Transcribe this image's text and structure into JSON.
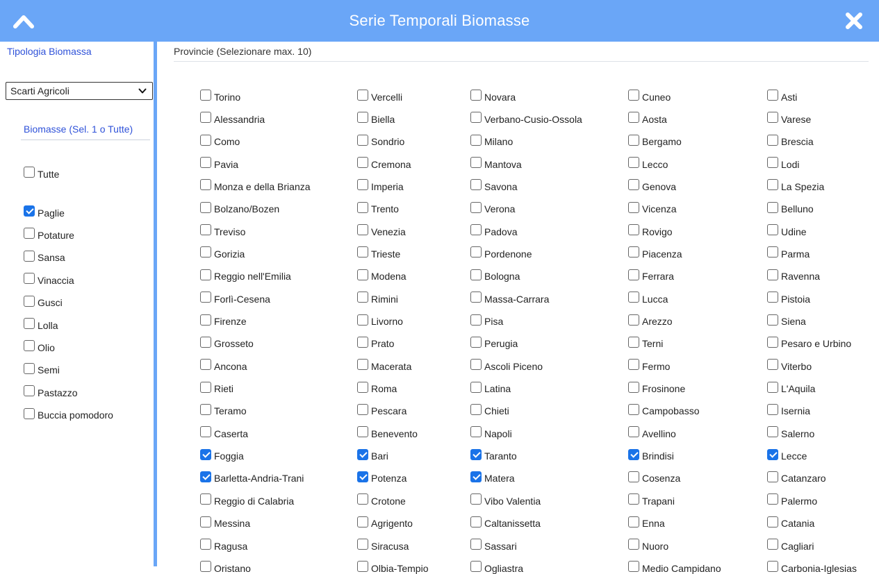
{
  "header": {
    "title": "Serie Temporali Biomasse"
  },
  "left": {
    "tipologia_label": "Tipologia Biomassa",
    "select_value": "Scarti Agricoli",
    "biomasse_label": "Biomasse (Sel. 1 o Tutte)",
    "tutte": {
      "label": "Tutte",
      "checked": false
    },
    "items": [
      {
        "label": "Paglie",
        "checked": true
      },
      {
        "label": "Potature",
        "checked": false
      },
      {
        "label": "Sansa",
        "checked": false
      },
      {
        "label": "Vinaccia",
        "checked": false
      },
      {
        "label": "Gusci",
        "checked": false
      },
      {
        "label": "Lolla",
        "checked": false
      },
      {
        "label": "Olio",
        "checked": false
      },
      {
        "label": "Semi",
        "checked": false
      },
      {
        "label": "Pastazzo",
        "checked": false
      },
      {
        "label": "Buccia pomodoro",
        "checked": false
      }
    ]
  },
  "right": {
    "province_label": "Provincie (Selezionare max. 10)",
    "province": [
      {
        "label": "Torino",
        "checked": false
      },
      {
        "label": "Vercelli",
        "checked": false
      },
      {
        "label": "Novara",
        "checked": false
      },
      {
        "label": "Cuneo",
        "checked": false
      },
      {
        "label": "Asti",
        "checked": false
      },
      {
        "label": "Alessandria",
        "checked": false
      },
      {
        "label": "Biella",
        "checked": false
      },
      {
        "label": "Verbano-Cusio-Ossola",
        "checked": false
      },
      {
        "label": "Aosta",
        "checked": false
      },
      {
        "label": "Varese",
        "checked": false
      },
      {
        "label": "Como",
        "checked": false
      },
      {
        "label": "Sondrio",
        "checked": false
      },
      {
        "label": "Milano",
        "checked": false
      },
      {
        "label": "Bergamo",
        "checked": false
      },
      {
        "label": "Brescia",
        "checked": false
      },
      {
        "label": "Pavia",
        "checked": false
      },
      {
        "label": "Cremona",
        "checked": false
      },
      {
        "label": "Mantova",
        "checked": false
      },
      {
        "label": "Lecco",
        "checked": false
      },
      {
        "label": "Lodi",
        "checked": false
      },
      {
        "label": "Monza e della Brianza",
        "checked": false
      },
      {
        "label": "Imperia",
        "checked": false
      },
      {
        "label": "Savona",
        "checked": false
      },
      {
        "label": "Genova",
        "checked": false
      },
      {
        "label": "La Spezia",
        "checked": false
      },
      {
        "label": "Bolzano/Bozen",
        "checked": false
      },
      {
        "label": "Trento",
        "checked": false
      },
      {
        "label": "Verona",
        "checked": false
      },
      {
        "label": "Vicenza",
        "checked": false
      },
      {
        "label": "Belluno",
        "checked": false
      },
      {
        "label": "Treviso",
        "checked": false
      },
      {
        "label": "Venezia",
        "checked": false
      },
      {
        "label": "Padova",
        "checked": false
      },
      {
        "label": "Rovigo",
        "checked": false
      },
      {
        "label": "Udine",
        "checked": false
      },
      {
        "label": "Gorizia",
        "checked": false
      },
      {
        "label": "Trieste",
        "checked": false
      },
      {
        "label": "Pordenone",
        "checked": false
      },
      {
        "label": "Piacenza",
        "checked": false
      },
      {
        "label": "Parma",
        "checked": false
      },
      {
        "label": "Reggio nell'Emilia",
        "checked": false
      },
      {
        "label": "Modena",
        "checked": false
      },
      {
        "label": "Bologna",
        "checked": false
      },
      {
        "label": "Ferrara",
        "checked": false
      },
      {
        "label": "Ravenna",
        "checked": false
      },
      {
        "label": "Forlì-Cesena",
        "checked": false
      },
      {
        "label": "Rimini",
        "checked": false
      },
      {
        "label": "Massa-Carrara",
        "checked": false
      },
      {
        "label": "Lucca",
        "checked": false
      },
      {
        "label": "Pistoia",
        "checked": false
      },
      {
        "label": "Firenze",
        "checked": false
      },
      {
        "label": "Livorno",
        "checked": false
      },
      {
        "label": "Pisa",
        "checked": false
      },
      {
        "label": "Arezzo",
        "checked": false
      },
      {
        "label": "Siena",
        "checked": false
      },
      {
        "label": "Grosseto",
        "checked": false
      },
      {
        "label": "Prato",
        "checked": false
      },
      {
        "label": "Perugia",
        "checked": false
      },
      {
        "label": "Terni",
        "checked": false
      },
      {
        "label": "Pesaro e Urbino",
        "checked": false
      },
      {
        "label": "Ancona",
        "checked": false
      },
      {
        "label": "Macerata",
        "checked": false
      },
      {
        "label": "Ascoli Piceno",
        "checked": false
      },
      {
        "label": "Fermo",
        "checked": false
      },
      {
        "label": "Viterbo",
        "checked": false
      },
      {
        "label": "Rieti",
        "checked": false
      },
      {
        "label": "Roma",
        "checked": false
      },
      {
        "label": "Latina",
        "checked": false
      },
      {
        "label": "Frosinone",
        "checked": false
      },
      {
        "label": "L'Aquila",
        "checked": false
      },
      {
        "label": "Teramo",
        "checked": false
      },
      {
        "label": "Pescara",
        "checked": false
      },
      {
        "label": "Chieti",
        "checked": false
      },
      {
        "label": "Campobasso",
        "checked": false
      },
      {
        "label": "Isernia",
        "checked": false
      },
      {
        "label": "Caserta",
        "checked": false
      },
      {
        "label": "Benevento",
        "checked": false
      },
      {
        "label": "Napoli",
        "checked": false
      },
      {
        "label": "Avellino",
        "checked": false
      },
      {
        "label": "Salerno",
        "checked": false
      },
      {
        "label": "Foggia",
        "checked": true
      },
      {
        "label": "Bari",
        "checked": true
      },
      {
        "label": "Taranto",
        "checked": true
      },
      {
        "label": "Brindisi",
        "checked": true
      },
      {
        "label": "Lecce",
        "checked": true
      },
      {
        "label": "Barletta-Andria-Trani",
        "checked": true
      },
      {
        "label": "Potenza",
        "checked": true
      },
      {
        "label": "Matera",
        "checked": true
      },
      {
        "label": "Cosenza",
        "checked": false
      },
      {
        "label": "Catanzaro",
        "checked": false
      },
      {
        "label": "Reggio di Calabria",
        "checked": false
      },
      {
        "label": "Crotone",
        "checked": false
      },
      {
        "label": "Vibo Valentia",
        "checked": false
      },
      {
        "label": "Trapani",
        "checked": false
      },
      {
        "label": "Palermo",
        "checked": false
      },
      {
        "label": "Messina",
        "checked": false
      },
      {
        "label": "Agrigento",
        "checked": false
      },
      {
        "label": "Caltanissetta",
        "checked": false
      },
      {
        "label": "Enna",
        "checked": false
      },
      {
        "label": "Catania",
        "checked": false
      },
      {
        "label": "Ragusa",
        "checked": false
      },
      {
        "label": "Siracusa",
        "checked": false
      },
      {
        "label": "Sassari",
        "checked": false
      },
      {
        "label": "Nuoro",
        "checked": false
      },
      {
        "label": "Cagliari",
        "checked": false
      },
      {
        "label": "Oristano",
        "checked": false
      },
      {
        "label": "Olbia-Tempio",
        "checked": false
      },
      {
        "label": "Ogliastra",
        "checked": false
      },
      {
        "label": "Medio Campidano",
        "checked": false
      },
      {
        "label": "Carbonia-Iglesias",
        "checked": false
      }
    ]
  },
  "colors": {
    "header": "#6aa6f7",
    "link": "#2f52d9",
    "checked": "#1a73e8"
  }
}
